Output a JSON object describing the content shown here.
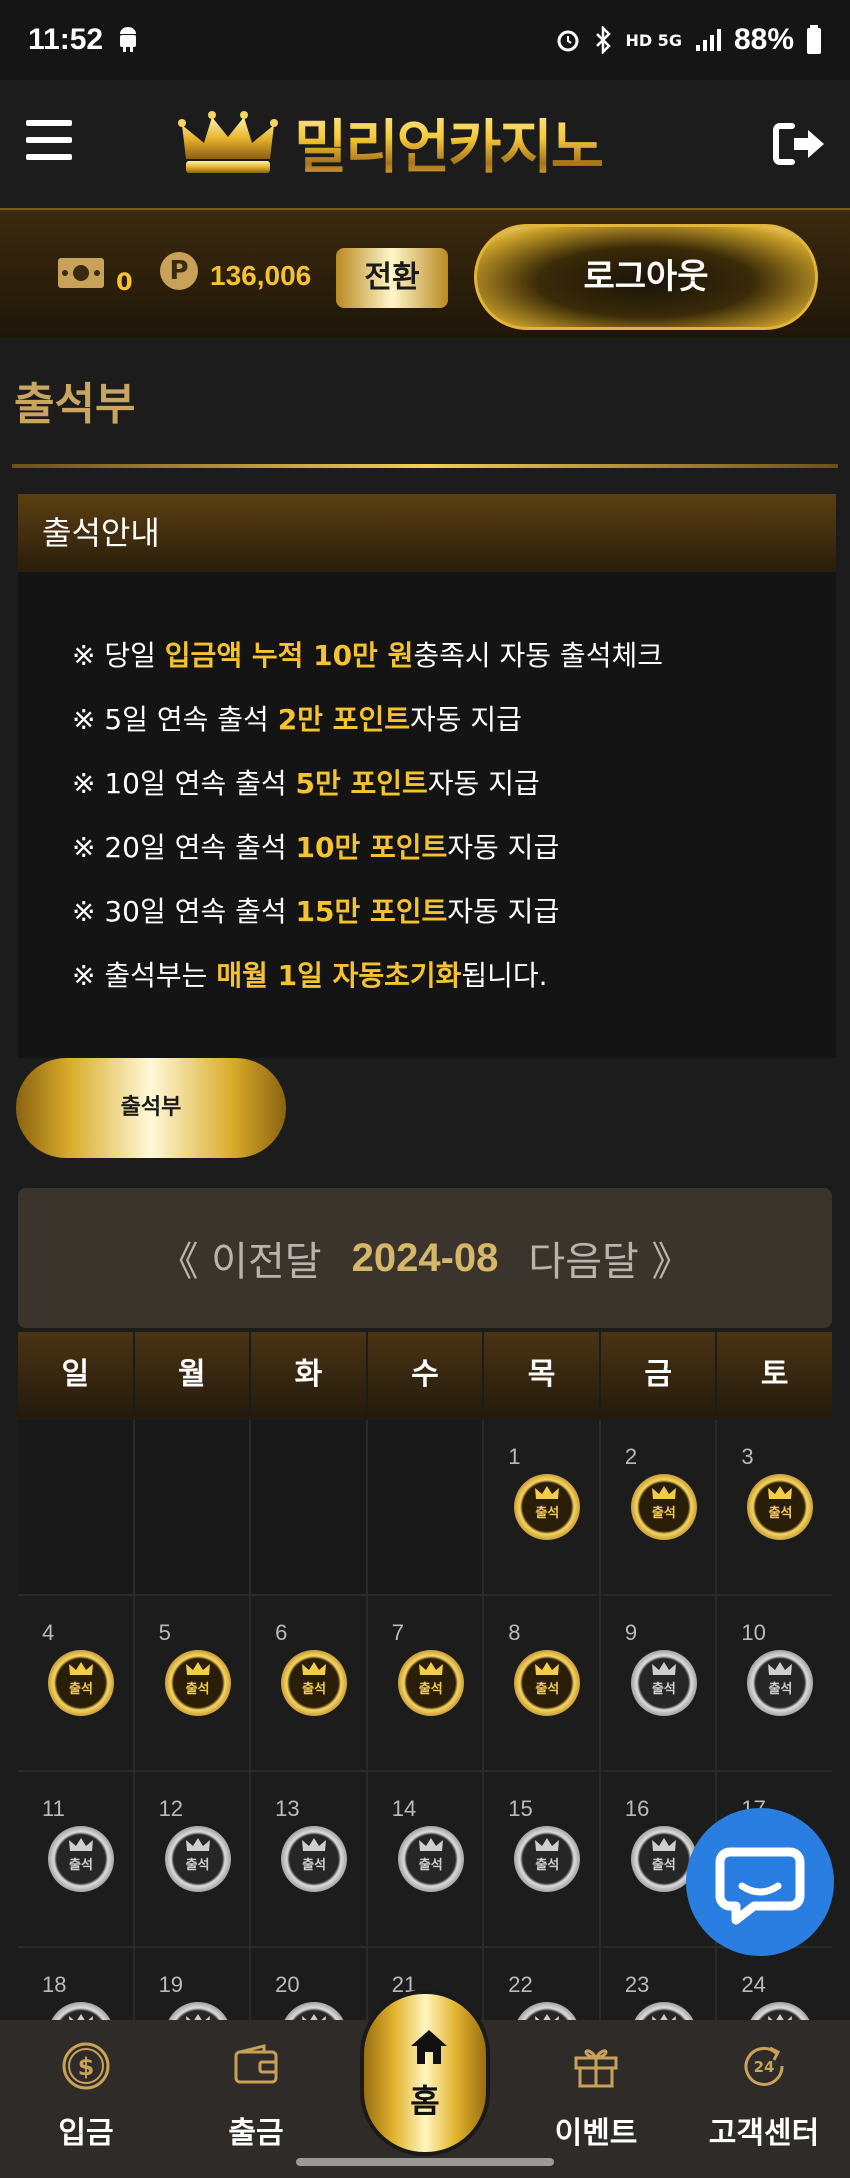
{
  "status_bar": {
    "time": "11:52",
    "network": "HD 5G",
    "battery": "88%"
  },
  "header": {
    "logo_text": "밀리언카지노"
  },
  "wallet": {
    "money": "0",
    "points": "136,006",
    "convert_label": "전환",
    "logout_label": "로그아웃"
  },
  "page": {
    "title": "출석부"
  },
  "info": {
    "heading": "출석안내",
    "lines": [
      {
        "pre": "※ 당일 ",
        "hl": "입금액 누적 10만 원",
        "post": "충족시 자동 출석체크"
      },
      {
        "pre": "※ 5일 연속 출석 ",
        "hl": "2만 포인트",
        "post": "자동 지급"
      },
      {
        "pre": "※ 10일 연속 출석 ",
        "hl": "5만 포인트",
        "post": "자동 지급"
      },
      {
        "pre": "※ 20일 연속 출석 ",
        "hl": "10만 포인트",
        "post": "자동 지급"
      },
      {
        "pre": "※ 30일 연속 출석 ",
        "hl": "15만 포인트",
        "post": "자동 지급"
      },
      {
        "pre": "※ 출석부는 ",
        "hl": "매월 1일 자동초기화",
        "post": "됩니다."
      }
    ]
  },
  "attend_button": "출석부",
  "calendar": {
    "prev_label": "《 이전달",
    "month": "2024-08",
    "next_label": "다음달 》",
    "weekdays": [
      "일",
      "월",
      "화",
      "수",
      "목",
      "금",
      "토"
    ],
    "badge_label": "출석",
    "first_weekday": 4,
    "days_shown": 24,
    "attended_days": [
      1,
      2,
      3,
      4,
      5,
      6,
      7,
      8
    ]
  },
  "bottom_nav": {
    "deposit": "입금",
    "withdraw": "출금",
    "home": "홈",
    "event": "이벤트",
    "support": "고객센터"
  },
  "colors": {
    "gold": "#f5c230",
    "chat": "#2a7de1"
  }
}
